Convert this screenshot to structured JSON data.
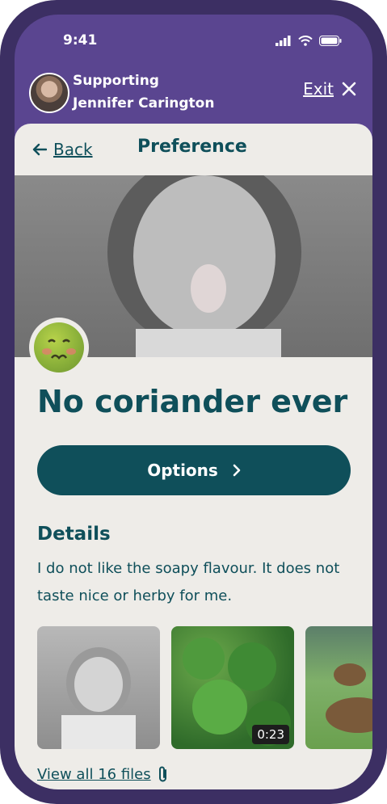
{
  "status_bar": {
    "time": "9:41"
  },
  "support": {
    "line1": "Supporting",
    "line2": "Jennifer Carington",
    "exit_label": "Exit"
  },
  "nav": {
    "back_label": "Back",
    "title": "Preference"
  },
  "preference": {
    "title": "No coriander ever",
    "options_label": "Options",
    "details_heading": "Details",
    "details_text": "I do not like the soapy flavour. It does not taste nice or herby for me."
  },
  "files": {
    "items": [
      {
        "kind": "photo"
      },
      {
        "kind": "video",
        "duration": "0:23"
      },
      {
        "kind": "photo"
      }
    ],
    "view_all_label": "View all 16 files"
  },
  "colors": {
    "brand_purple": "#5a4590",
    "teal": "#0f4f5a",
    "card_bg": "#eeece8"
  }
}
